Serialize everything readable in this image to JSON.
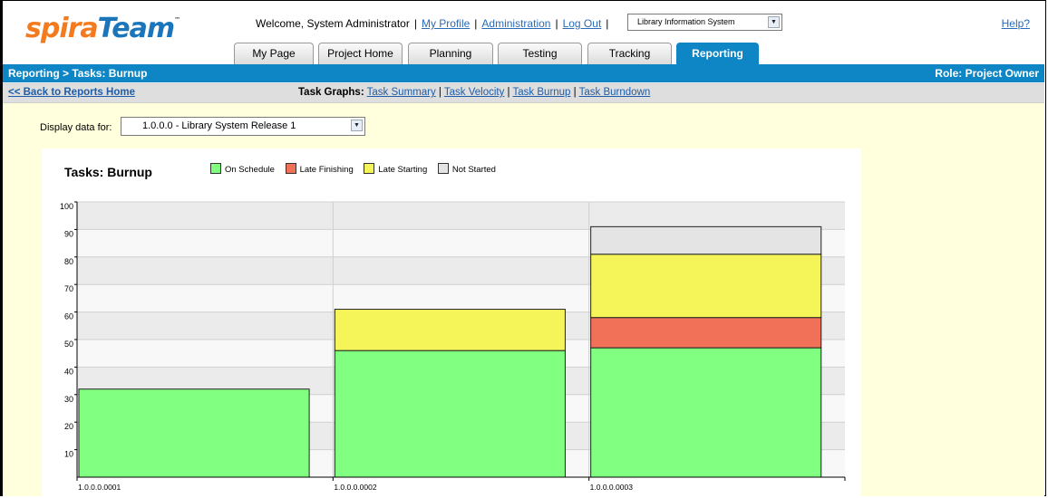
{
  "header": {
    "logo_part1": "spira",
    "logo_part2": "Team",
    "logo_mark": "™",
    "welcome": "Welcome, System Administrator",
    "my_profile": "My Profile",
    "administration": "Administration",
    "log_out": "Log Out",
    "project_select": "Library Information System",
    "help": "Help?"
  },
  "tabs": [
    "My Page",
    "Project Home",
    "Planning",
    "Testing",
    "Tracking",
    "Reporting"
  ],
  "active_tab": "Reporting",
  "bluebar": {
    "breadcrumb": "Reporting > Tasks: Burnup",
    "role": "Role: Project Owner"
  },
  "subnav": {
    "back": "<< Back to Reports Home",
    "graphs_label": "Task Graphs:",
    "links": [
      "Task Summary",
      "Task Velocity",
      "Task Burnup",
      "Task Burndown"
    ]
  },
  "filter": {
    "label": "Display data for:",
    "value": "1.0.0.0 - Library System Release 1"
  },
  "colors": {
    "accent": "#0e86c6",
    "on_schedule": "#80ff80",
    "late_finishing": "#f07058",
    "late_starting": "#f5f55a",
    "not_started": "#e4e4e4"
  },
  "chart_data": {
    "type": "bar",
    "stacked": true,
    "title": "Tasks: Burnup",
    "categories": [
      "1.0.0.0.0001",
      "1.0.0.0.0002",
      "1.0.0.0.0003"
    ],
    "series": [
      {
        "name": "On Schedule",
        "values": [
          32,
          46,
          47
        ]
      },
      {
        "name": "Late Finishing",
        "values": [
          0,
          0,
          11
        ]
      },
      {
        "name": "Late Starting",
        "values": [
          0,
          15,
          23
        ]
      },
      {
        "name": "Not Started",
        "values": [
          0,
          0,
          10
        ]
      }
    ],
    "ylim": [
      0,
      100
    ],
    "yticks": [
      10,
      20,
      30,
      40,
      50,
      60,
      70,
      80,
      90,
      100
    ],
    "grid": true,
    "legend_position": "top"
  }
}
